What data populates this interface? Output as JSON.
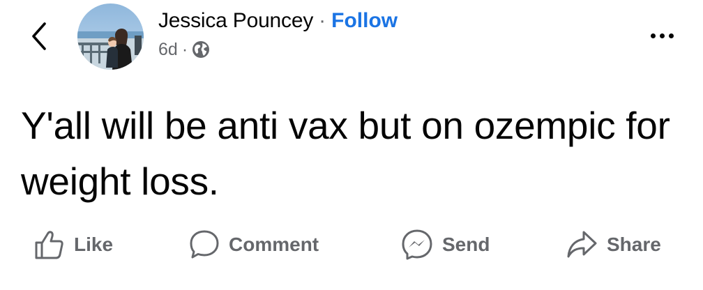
{
  "post": {
    "author_name": "Jessica Pouncey",
    "separator": "·",
    "follow_label": "Follow",
    "time": "6d",
    "meta_dot": "·",
    "audience_icon": "globe-icon",
    "text": "Y'all will be anti vax but on ozempic for weight loss."
  },
  "header": {
    "back_icon": "chevron-left-icon",
    "more_icon": "more-horizontal-icon"
  },
  "actions": [
    {
      "label": "Like",
      "icon": "thumbs-up-icon"
    },
    {
      "label": "Comment",
      "icon": "comment-bubble-icon"
    },
    {
      "label": "Send",
      "icon": "messenger-icon"
    },
    {
      "label": "Share",
      "icon": "share-arrow-icon"
    }
  ],
  "colors": {
    "text": "#050505",
    "secondary": "#65676b",
    "link": "#1b74e4",
    "background": "#ffffff"
  }
}
